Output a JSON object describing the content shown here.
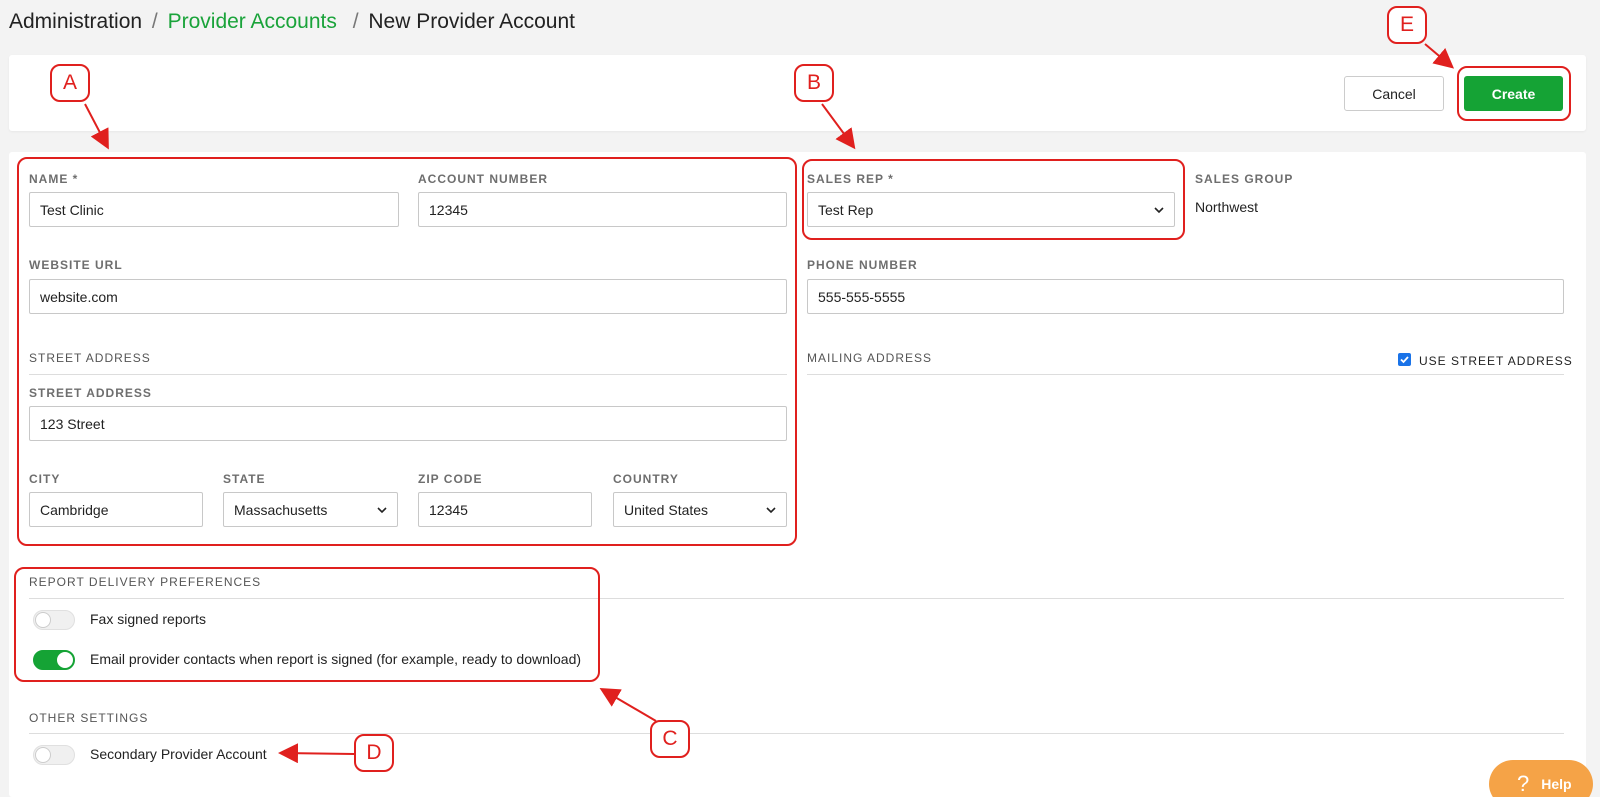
{
  "breadcrumb": {
    "root": "Administration",
    "separator": "/",
    "parent": "Provider Accounts",
    "current": "New Provider Account"
  },
  "toolbar": {
    "cancel_label": "Cancel",
    "create_label": "Create"
  },
  "form": {
    "name": {
      "label": "NAME *",
      "value": "Test Clinic"
    },
    "account_number": {
      "label": "ACCOUNT NUMBER",
      "value": "12345"
    },
    "website_url": {
      "label": "WEBSITE URL",
      "value": "website.com"
    },
    "street_section": {
      "label": "STREET ADDRESS"
    },
    "street_address": {
      "label": "STREET ADDRESS",
      "value": "123 Street"
    },
    "city": {
      "label": "CITY",
      "value": "Cambridge"
    },
    "state": {
      "label": "STATE",
      "value": "Massachusetts"
    },
    "zip_code": {
      "label": "ZIP CODE",
      "value": "12345"
    },
    "country": {
      "label": "COUNTRY",
      "value": "United States"
    },
    "sales_rep": {
      "label": "SALES REP *",
      "value": "Test Rep"
    },
    "sales_group": {
      "label": "SALES GROUP",
      "value": "Northwest"
    },
    "phone_number": {
      "label": "PHONE NUMBER",
      "value": "555-555-5555"
    },
    "mailing_section": {
      "label": "MAILING ADDRESS"
    },
    "use_street_address": {
      "label": "USE STREET ADDRESS",
      "checked": true
    }
  },
  "report_delivery": {
    "label": "REPORT DELIVERY PREFERENCES",
    "fax": {
      "label": "Fax signed reports",
      "on": false
    },
    "email": {
      "label": "Email provider contacts when report is signed (for example, ready to download)",
      "on": true
    }
  },
  "other_settings": {
    "label": "OTHER SETTINGS",
    "secondary": {
      "label": "Secondary Provider Account",
      "on": false
    }
  },
  "annotations": {
    "a": "A",
    "b": "B",
    "c": "C",
    "d": "D",
    "e": "E",
    "color": "#e0201e"
  },
  "help": {
    "label": "Help",
    "icon": "question-icon"
  },
  "colors": {
    "accent_green": "#15a335",
    "link_green": "#1aa33a",
    "help_orange": "#f5a347",
    "checkbox_blue": "#1a73e8"
  }
}
